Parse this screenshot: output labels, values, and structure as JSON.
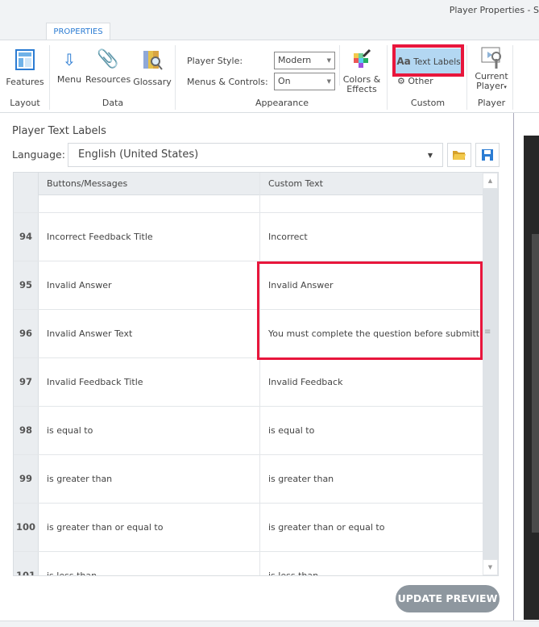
{
  "window": {
    "title": "Player Properties - S"
  },
  "ribbon": {
    "tab": "PROPERTIES",
    "features": "Features",
    "menu": "Menu",
    "resources": "Resources",
    "glossary": "Glossary",
    "player_style_label": "Player Style:",
    "player_style": "Modern",
    "menus_label": "Menus & Controls:",
    "menus": "On",
    "colors1": "Colors &",
    "colors2": "Effects",
    "text_labels": "Text Labels",
    "text_labels_aa": "Aa",
    "other": "Other",
    "current1": "Current",
    "current2": "Player",
    "groups": {
      "layout": "Layout",
      "data": "Data",
      "appearance": "Appearance",
      "custom": "Custom",
      "player": "Player"
    }
  },
  "panel": {
    "heading": "Player Text Labels",
    "language_label": "Language:",
    "language": "English (United States)"
  },
  "grid": {
    "headers": [
      "Buttons/Messages",
      "Custom Text"
    ],
    "rows": [
      {
        "num": "94",
        "name": "Incorrect Feedback Title",
        "text": "Incorrect"
      },
      {
        "num": "95",
        "name": "Invalid Answer",
        "text": "Invalid Answer"
      },
      {
        "num": "96",
        "name": "Invalid Answer Text",
        "text": "You must complete the question before submitting."
      },
      {
        "num": "97",
        "name": "Invalid Feedback Title",
        "text": "Invalid Feedback"
      },
      {
        "num": "98",
        "name": "is equal to",
        "text": "is equal to"
      },
      {
        "num": "99",
        "name": "is greater than",
        "text": "is greater than"
      },
      {
        "num": "100",
        "name": "is greater than or equal to",
        "text": "is greater than or equal to"
      },
      {
        "num": "101",
        "name": "is less than",
        "text": "is less than"
      }
    ]
  },
  "update_button": "UPDATE PREVIEW",
  "colors": {
    "highlight": "#e8163c",
    "accent": "#2b7cd3",
    "selected": "#b3d7f2"
  }
}
